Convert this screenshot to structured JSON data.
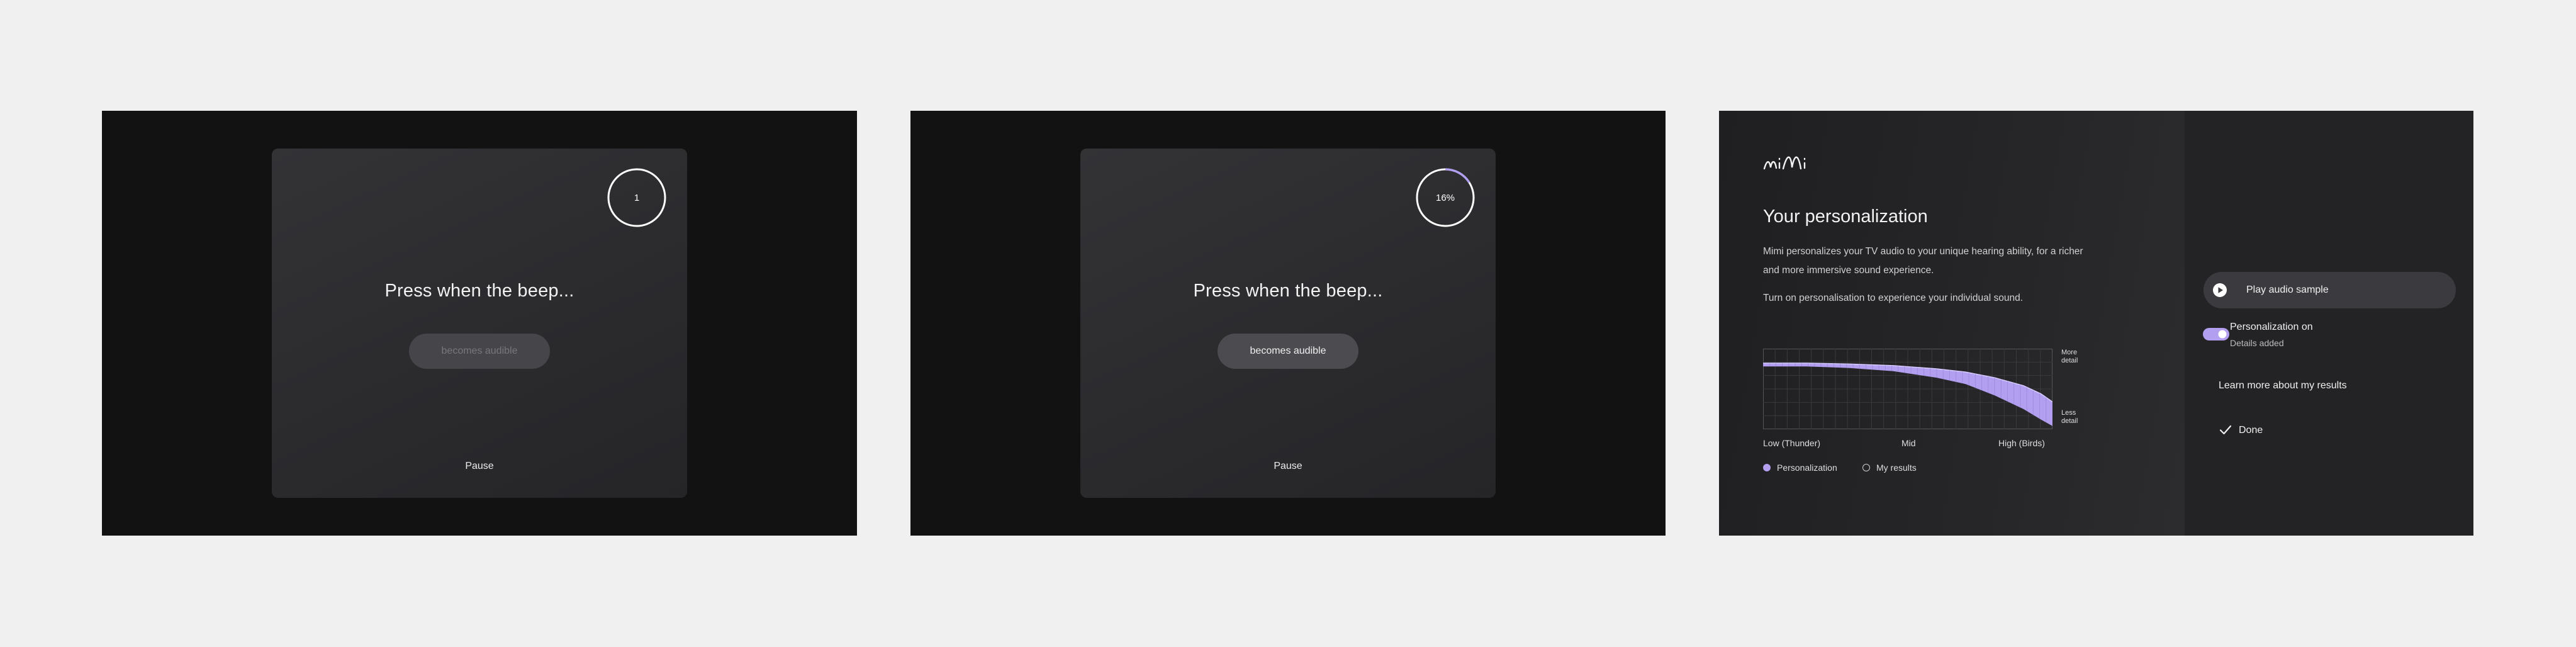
{
  "colors": {
    "accent": "#b39ff0",
    "background": "#121212",
    "card": "#2e2e31"
  },
  "screen_1": {
    "progress": 0,
    "progress_label": "1",
    "title": "Press when the beep...",
    "button_label": "becomes audible",
    "pause_label": "Pause"
  },
  "screen_2": {
    "progress": 0.16,
    "progress_label": "16%",
    "title": "Press when the beep...",
    "button_label": "becomes audible",
    "pause_label": "Pause"
  },
  "screen_3": {
    "logo_text": "mimi",
    "title": "Your personalization",
    "description": "Mimi personalizes your TV audio to your unique hearing ability, for a richer and more immersive sound experience.",
    "instruction": "Turn on personalisation to experience your individual sound.",
    "chart_data": {
      "type": "area",
      "x_tick_labels": [
        "Low (Thunder)",
        "Mid",
        "High (Birds)"
      ],
      "y_tick_labels": [
        "More detail",
        "Less detail"
      ],
      "grid": true,
      "legend": [
        "Personalization",
        "My results"
      ],
      "legend_placement": "bottom-left",
      "series": [
        {
          "name": "Personalization",
          "x": [
            0,
            0.15,
            0.3,
            0.45,
            0.6,
            0.7,
            0.8,
            0.9,
            0.96,
            1.0
          ],
          "upper": [
            0.82,
            0.82,
            0.81,
            0.79,
            0.75,
            0.71,
            0.64,
            0.54,
            0.44,
            0.34
          ],
          "lower": [
            0.78,
            0.78,
            0.76,
            0.72,
            0.64,
            0.56,
            0.42,
            0.25,
            0.12,
            0.04
          ]
        }
      ]
    },
    "menu": {
      "play_label": "Play audio sample",
      "toggle_label": "Personalization on",
      "toggle_sub": "Details added",
      "toggle_on": true,
      "learn_label": "Learn more about my results",
      "done_label": "Done"
    },
    "icons": [
      "play-icon",
      "toggle-icon",
      "check-icon"
    ]
  }
}
